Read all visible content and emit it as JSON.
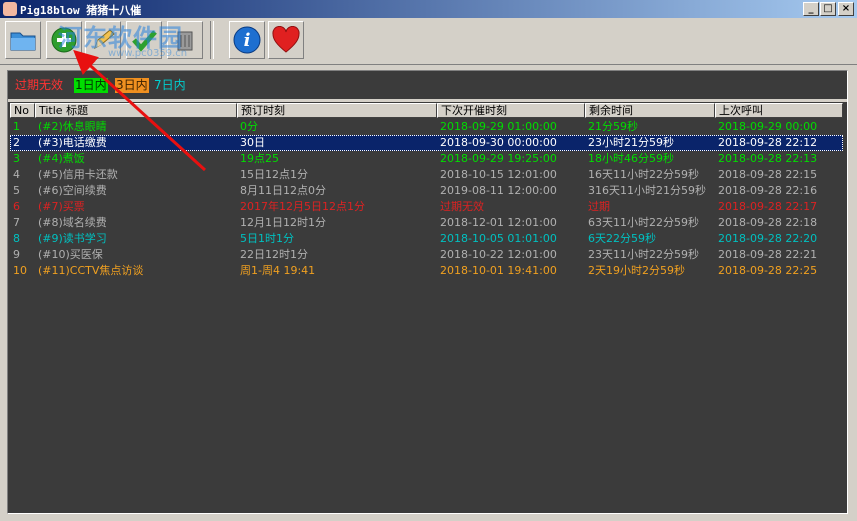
{
  "window": {
    "title": "Pig18blow 猪猪十八催",
    "min": "_",
    "max": "□",
    "close": "×"
  },
  "watermark": {
    "text": "河东软件园",
    "url": "www.pc0359.cn"
  },
  "legend": [
    {
      "label": "过期无效",
      "color": "#ff3333",
      "bg": "#3b3b3b"
    },
    {
      "label": "1日内",
      "color": "#003300",
      "bg": "#00dd00"
    },
    {
      "label": "3日内",
      "color": "#3b2000",
      "bg": "#f09020"
    },
    {
      "label": "7日内",
      "color": "#ffffff",
      "bg": "#3b3b3b",
      "text_color": "#00d0d0"
    }
  ],
  "columns": [
    "No",
    "Title 标题",
    "预订时刻",
    "下次开催时刻",
    "剩余时间",
    "上次呼叫"
  ],
  "rows": [
    {
      "no": "1",
      "title": "(#2)休息眼睛",
      "preset": "0分",
      "next": "2018-09-29 01:00:00",
      "remain": "21分59秒",
      "last": "2018-09-29 00:00",
      "color": "#00dd00"
    },
    {
      "no": "2",
      "title": "(#3)电话缴费",
      "preset": "30日",
      "next": "2018-09-30 00:00:00",
      "remain": "23小时21分59秒",
      "last": "2018-09-28 22:12",
      "color": "#ffffff",
      "selected": true
    },
    {
      "no": "3",
      "title": "(#4)煮饭",
      "preset": "19点25",
      "next": "2018-09-29 19:25:00",
      "remain": "18小时46分59秒",
      "last": "2018-09-28 22:13",
      "color": "#00dd00"
    },
    {
      "no": "4",
      "title": "(#5)信用卡还款",
      "preset": "15日12点1分",
      "next": "2018-10-15 12:01:00",
      "remain": "16天11小时22分59秒",
      "last": "2018-09-28 22:15",
      "color": "#b0b0b0"
    },
    {
      "no": "5",
      "title": "(#6)空间续费",
      "preset": "8月11日12点0分",
      "next": "2019-08-11 12:00:00",
      "remain": "316天11小时21分59秒",
      "last": "2018-09-28 22:16",
      "color": "#b0b0b0"
    },
    {
      "no": "6",
      "title": "(#7)买票",
      "preset": "2017年12月5日12点1分",
      "next": "过期无效",
      "remain": "过期",
      "last": "2018-09-28 22:17",
      "color": "#dd2222"
    },
    {
      "no": "7",
      "title": "(#8)域名续费",
      "preset": "12月1日12时1分",
      "next": "2018-12-01 12:01:00",
      "remain": "63天11小时22分59秒",
      "last": "2018-09-28 22:18",
      "color": "#b0b0b0"
    },
    {
      "no": "8",
      "title": "(#9)读书学习",
      "preset": "5日1时1分",
      "next": "2018-10-05 01:01:00",
      "remain": "6天22分59秒",
      "last": "2018-09-28 22:20",
      "color": "#00c0c0"
    },
    {
      "no": "9",
      "title": "(#10)买医保",
      "preset": "22日12时1分",
      "next": "2018-10-22 12:01:00",
      "remain": "23天11小时22分59秒",
      "last": "2018-09-28 22:21",
      "color": "#b0b0b0"
    },
    {
      "no": "10",
      "title": "(#11)CCTV焦点访谈",
      "preset": "周1-周4 19:41",
      "next": "2018-10-01 19:41:00",
      "remain": "2天19小时2分59秒",
      "last": "2018-09-28 22:25",
      "color": "#f0a020"
    }
  ],
  "toolbar": {
    "buttons": [
      {
        "name": "open-button",
        "icon": "folder-icon"
      },
      {
        "name": "add-button",
        "icon": "plus-icon"
      },
      {
        "name": "edit-button",
        "icon": "pencil-icon"
      },
      {
        "name": "confirm-button",
        "icon": "check-icon"
      },
      {
        "name": "delete-button",
        "icon": "trash-icon"
      },
      {
        "name": "info-button",
        "icon": "info-icon",
        "glyph": "i"
      },
      {
        "name": "favorite-button",
        "icon": "heart-icon"
      }
    ]
  }
}
